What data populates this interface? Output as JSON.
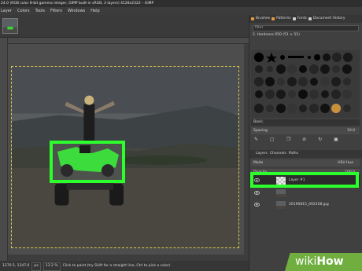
{
  "window": {
    "title": "24.0 (RGB color 8-bit gamma integer, GIMP built-in sRGB, 3 layers) 4128x2322 – GIMP"
  },
  "menu": [
    "Layer",
    "Colors",
    "Tools",
    "Filters",
    "Windows",
    "Help"
  ],
  "statusbar": {
    "coords": "1270.5, 1347.0",
    "unit": "px",
    "zoom": "13.2 %",
    "message": "Click to paint (try Shift for a straight line, Ctrl to pick a color)"
  },
  "brushes_panel": {
    "tabs": [
      "Brushes",
      "Patterns",
      "Fonts",
      "Document History"
    ],
    "filter_placeholder": "filter",
    "brush_name": "2. Hardness 050 (51 × 51)",
    "preset": "Basic.",
    "spacing_label": "Spacing",
    "spacing_value": "10.0"
  },
  "layers_panel": {
    "tabs": [
      "Layers",
      "Channels",
      "Paths"
    ],
    "mode_label": "Mode",
    "mode_value": "HSV Hue",
    "opacity_label": "Opacity",
    "opacity_value": "100.0",
    "layers": [
      {
        "name": "Layer #1",
        "active": true
      },
      {
        "name": "",
        "active": false
      },
      {
        "name": "20190815_092208.jpg",
        "active": false
      }
    ]
  },
  "highlight_color": "#2dff2d",
  "watermark": {
    "part1": "wiki",
    "part2": "How"
  }
}
